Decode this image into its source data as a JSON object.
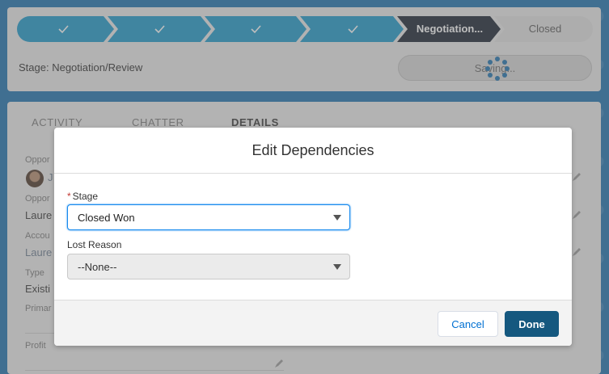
{
  "path": {
    "completed_steps": [
      "step-1",
      "step-2",
      "step-3",
      "step-4"
    ],
    "current_label": "Negotiation...",
    "next_label": "Closed",
    "colors": {
      "completed": "#1b97c9",
      "current": "#17202e",
      "upcoming": "#e0e0e0"
    }
  },
  "stage_summary": "Stage: Negotiation/Review",
  "saving_label": "Saving...",
  "tabs": [
    "ACTIVITY",
    "CHATTER",
    "DETAILS"
  ],
  "details": {
    "fields": [
      {
        "label": "Oppor",
        "value": "J"
      },
      {
        "label": "Oppor",
        "value": "Laure"
      },
      {
        "label": "Accou",
        "value": "Laure"
      },
      {
        "label": "Type",
        "value": "Existi"
      },
      {
        "label": "Primar",
        "value": ""
      },
      {
        "label": "Profit",
        "value": ""
      }
    ]
  },
  "modal": {
    "title": "Edit Dependencies",
    "stage_label": "Stage",
    "stage_required_marker": "*",
    "stage_value": "Closed Won",
    "lost_reason_label": "Lost Reason",
    "lost_reason_value": "--None--",
    "cancel_label": "Cancel",
    "done_label": "Done"
  }
}
